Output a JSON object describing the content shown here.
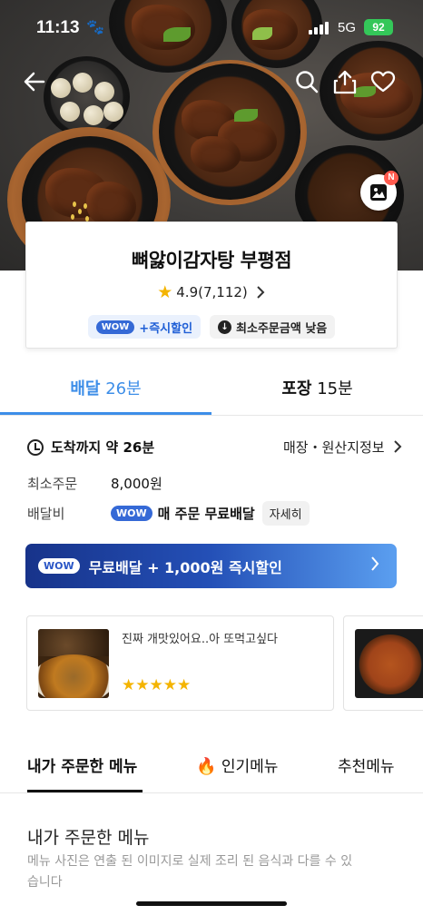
{
  "status_bar": {
    "time": "11:13",
    "network": "5G",
    "battery": "92"
  },
  "store": {
    "name": "뼈앓이감자탕 부평점",
    "rating": "4.9",
    "review_count": "(7,112)",
    "badge_wow": "WOW",
    "badge_discount": "+즉시할인",
    "badge_min_order": "최소주문금액 낮음"
  },
  "tabs": [
    {
      "label": "배달",
      "value": "26분",
      "active": true
    },
    {
      "label": "포장",
      "value": "15분",
      "active": false
    }
  ],
  "delivery_info": {
    "arrival_label": "도착까지 약 26분",
    "store_info_link": "매장・원산지정보",
    "min_order_label": "최소주문",
    "min_order_value": "8,000원",
    "delivery_fee_label": "배달비",
    "wow_label": "WOW",
    "delivery_fee_value": "매 주문 무료배달",
    "detail_button": "자세히"
  },
  "banner": {
    "wow_label": "WOW",
    "text": "무료배달 + 1,000원 즉시할인"
  },
  "reviews": [
    {
      "text": "진짜 개맛있어요..아 또먹고싶다",
      "stars": 5
    }
  ],
  "menu_tabs": [
    {
      "label": "내가 주문한 메뉴",
      "active": true
    },
    {
      "label": "인기메뉴",
      "active": false
    },
    {
      "label": "추천메뉴",
      "active": false
    }
  ],
  "section": {
    "title": "내가 주문한 메뉴",
    "description": "메뉴 사진은 연출 된 이미지로 실제 조리 된 음식과 다를 수 있습니다"
  },
  "photo_badge": "N",
  "colors": {
    "accent": "#3d8ee8",
    "wow_blue": "#3569d6",
    "star": "#f4b400",
    "badge_red": "#ff5a4e"
  }
}
